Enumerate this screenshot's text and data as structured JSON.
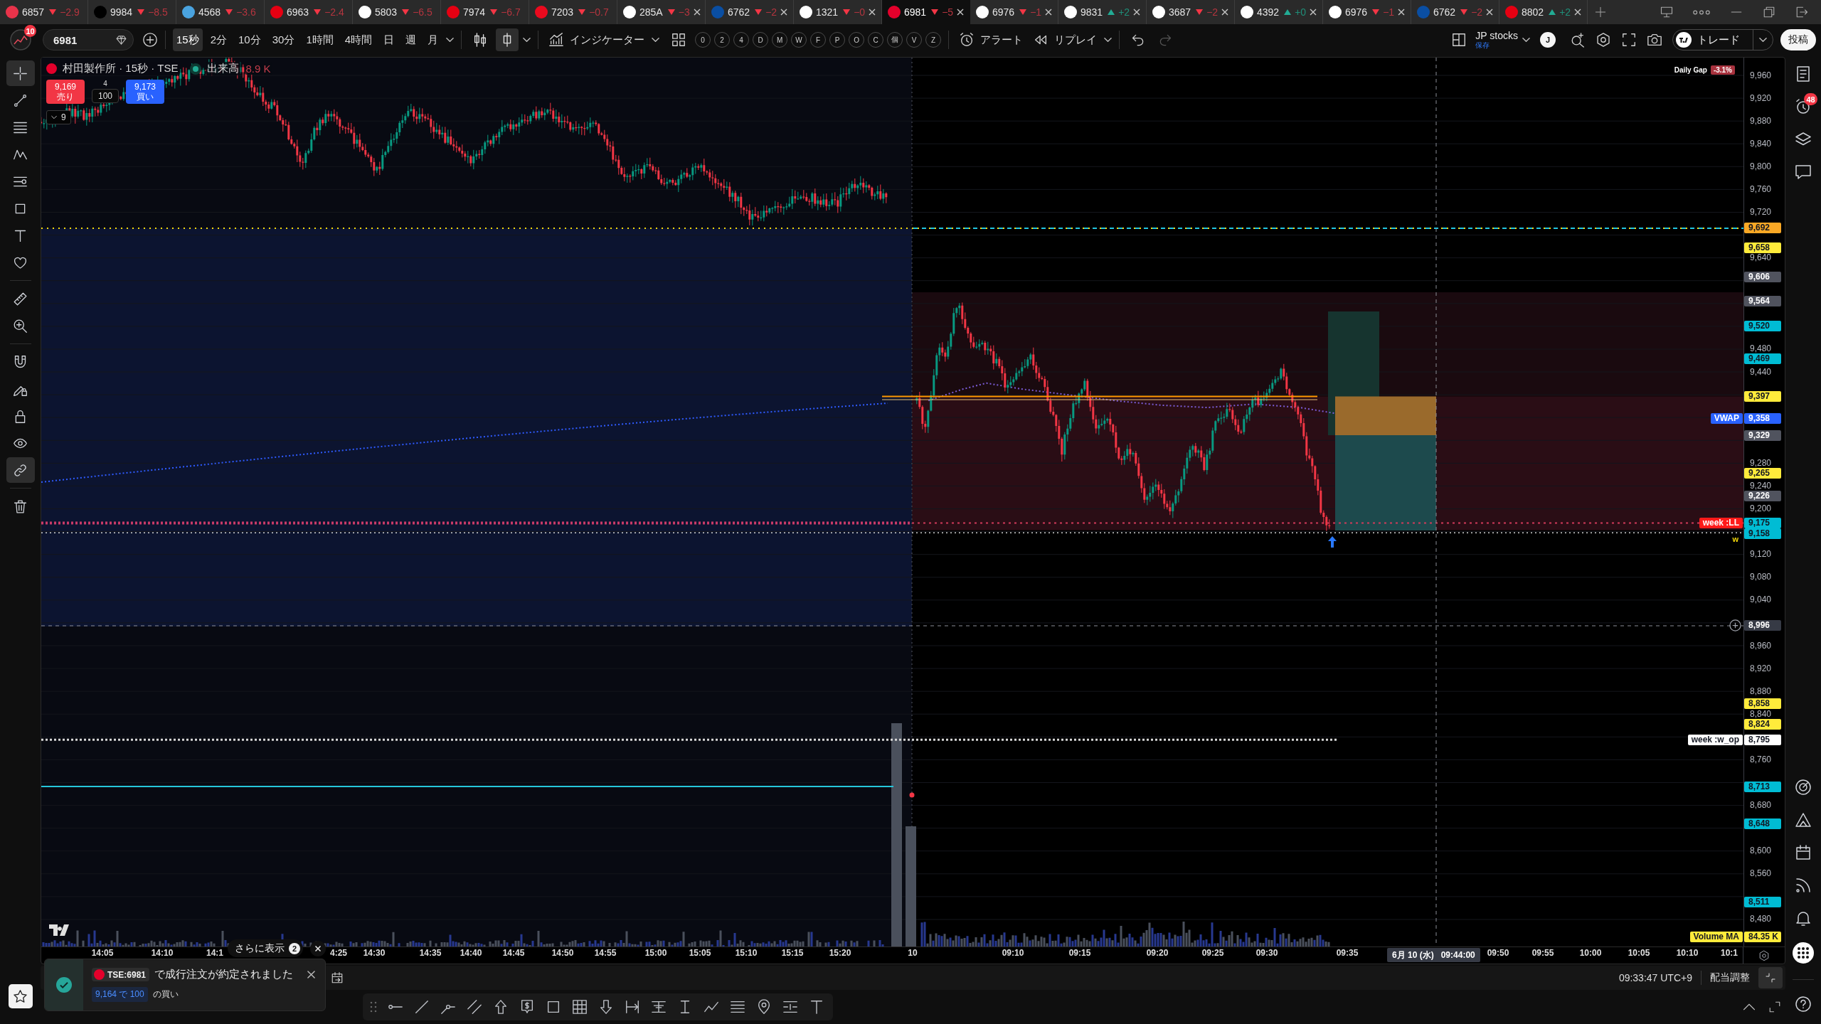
{
  "tabs": [
    {
      "symbol": "6857",
      "rising": false,
      "change": "−2.9",
      "color": "#e8334a",
      "closable": false,
      "selected": false
    },
    {
      "symbol": "9984",
      "rising": false,
      "change": "−8.5",
      "color": "#000000",
      "closable": false,
      "selected": false
    },
    {
      "symbol": "4568",
      "rising": false,
      "change": "−3.6",
      "color": "#4aa3df",
      "closable": false,
      "selected": false
    },
    {
      "symbol": "6963",
      "rising": false,
      "change": "−2.4",
      "color": "#e60012",
      "closable": false,
      "selected": false
    },
    {
      "symbol": "5803",
      "rising": false,
      "change": "−6.5",
      "color": "#ffffff",
      "closable": false,
      "selected": false
    },
    {
      "symbol": "7974",
      "rising": false,
      "change": "−6.7",
      "color": "#e60012",
      "closable": false,
      "selected": false
    },
    {
      "symbol": "7203",
      "rising": false,
      "change": "−0.7",
      "color": "#eb0a1e",
      "closable": false,
      "selected": false
    },
    {
      "symbol": "285A",
      "rising": false,
      "change": "−3",
      "color": "#ffffff",
      "closable": true,
      "selected": false
    },
    {
      "symbol": "6762",
      "rising": false,
      "change": "−2",
      "color": "#0a4ea2",
      "closable": true,
      "selected": false
    },
    {
      "symbol": "1321",
      "rising": false,
      "change": "−0",
      "color": "#ffffff",
      "closable": true,
      "selected": false
    },
    {
      "symbol": "6981",
      "rising": false,
      "change": "−5",
      "color": "#e4002b",
      "closable": true,
      "selected": true
    },
    {
      "symbol": "6976",
      "rising": false,
      "change": "−1",
      "color": "#ffffff",
      "closable": true,
      "selected": false
    },
    {
      "symbol": "9831",
      "rising": true,
      "change": "+2",
      "color": "#ffffff",
      "closable": true,
      "selected": false
    },
    {
      "symbol": "3687",
      "rising": false,
      "change": "−2",
      "color": "#ffffff",
      "closable": true,
      "selected": false
    },
    {
      "symbol": "4392",
      "rising": true,
      "change": "+0",
      "color": "#ffffff",
      "closable": true,
      "selected": false
    },
    {
      "symbol": "6976",
      "rising": false,
      "change": "−1",
      "color": "#ffffff",
      "closable": true,
      "selected": false
    },
    {
      "symbol": "6762",
      "rising": false,
      "change": "−2",
      "color": "#0a4ea2",
      "closable": true,
      "selected": false
    },
    {
      "symbol": "8802",
      "rising": true,
      "change": "+2",
      "color": "#e60012",
      "closable": true,
      "selected": false
    }
  ],
  "toolbar": {
    "notification_count": "10",
    "symbol": "6981",
    "intervals": [
      {
        "label": "15秒",
        "selected": true
      },
      {
        "label": "2分",
        "selected": false
      },
      {
        "label": "10分",
        "selected": false
      },
      {
        "label": "30分",
        "selected": false
      },
      {
        "label": "1時間",
        "selected": false
      },
      {
        "label": "4時間",
        "selected": false
      },
      {
        "label": "日",
        "selected": false
      },
      {
        "label": "週",
        "selected": false
      },
      {
        "label": "月",
        "selected": false
      }
    ],
    "chart_styles": [
      {
        "kind": "candles",
        "selected": false
      },
      {
        "kind": "hollow-candles",
        "selected": true
      }
    ],
    "indicators_label": "インジケーター",
    "quick_buttons": [
      "0",
      "2",
      "4",
      "D",
      "M",
      "W",
      "F",
      "P",
      "O",
      "C",
      "個",
      "V",
      "Z"
    ],
    "alert_label": "アラート",
    "replay_label": "リプレイ",
    "history": [
      {
        "kind": "undo",
        "disabled": false
      },
      {
        "kind": "redo",
        "disabled": true
      }
    ],
    "layout_name": "JP stocks",
    "layout_status": "保存",
    "account_initial": "J",
    "trade_label": "トレード",
    "publish_label": "投稿"
  },
  "left_toolbar": {
    "groups": [
      [
        {
          "kind": "crosshair",
          "selected": true
        },
        {
          "kind": "trend-line",
          "selected": false
        },
        {
          "kind": "fib",
          "selected": false
        },
        {
          "kind": "pattern",
          "selected": false
        },
        {
          "kind": "forecast",
          "selected": false
        },
        {
          "kind": "shape",
          "selected": false
        },
        {
          "kind": "text",
          "selected": false
        },
        {
          "kind": "heart",
          "selected": false
        }
      ],
      [
        {
          "kind": "ruler",
          "selected": false
        },
        {
          "kind": "zoom",
          "selected": false
        }
      ],
      [
        {
          "kind": "magnet",
          "selected": false
        },
        {
          "kind": "lock-pencil",
          "selected": false
        },
        {
          "kind": "lock",
          "selected": false
        },
        {
          "kind": "eye",
          "selected": false
        },
        {
          "kind": "link",
          "selected": true
        }
      ],
      [
        {
          "kind": "trash",
          "selected": false
        }
      ]
    ],
    "bottom": [
      {
        "kind": "star",
        "selected": false
      }
    ]
  },
  "chart": {
    "title": "村田製作所 · 15秒 · TSE",
    "market_open": true,
    "volume_label": "出来高",
    "volume_value": "8.9 K",
    "order_panel": {
      "sell_price": "9,169",
      "sell_label": "売り",
      "spread": "4",
      "quantity": "100",
      "buy_price": "9,173",
      "buy_label": "買い"
    },
    "indicator_count": "9",
    "daily_gap": {
      "label": "Daily Gap",
      "value": "-3.1%"
    },
    "level_marker": "w",
    "price_scale": [
      {
        "text": "9,960",
        "kind": "tick"
      },
      {
        "text": "9,920",
        "kind": "tick"
      },
      {
        "text": "9,880",
        "kind": "tick"
      },
      {
        "text": "9,840",
        "kind": "tick"
      },
      {
        "text": "9,800",
        "kind": "tick"
      },
      {
        "text": "9,760",
        "kind": "tick"
      },
      {
        "text": "9,720",
        "kind": "tick"
      },
      {
        "text": "9,692",
        "kind": "badge",
        "color": "#f9a825"
      },
      {
        "text": "9,658",
        "kind": "badge",
        "color": "#ffeb3b"
      },
      {
        "text": "9,640",
        "kind": "tick"
      },
      {
        "text": "9,606",
        "kind": "badge",
        "color": "#50535e"
      },
      {
        "text": "9,564",
        "kind": "badge",
        "color": "#50535e"
      },
      {
        "text": "9,520",
        "kind": "badge",
        "color": "#00bcd4"
      },
      {
        "text": "9,480",
        "kind": "tick"
      },
      {
        "text": "9,469",
        "kind": "badge",
        "color": "#00bcd4"
      },
      {
        "text": "9,440",
        "kind": "tick"
      },
      {
        "text": "9,397",
        "kind": "badge",
        "color": "#ffeb3b"
      },
      {
        "text": "9,358",
        "kind": "badge",
        "color": "#2962ff",
        "tag": {
          "text": "VWAP",
          "color": "#2962ff"
        }
      },
      {
        "text": "9,329",
        "kind": "badge",
        "color": "#50535e"
      },
      {
        "text": "9,280",
        "kind": "tick"
      },
      {
        "text": "9,265",
        "kind": "badge",
        "color": "#ffeb3b"
      },
      {
        "text": "9,240",
        "kind": "tick"
      },
      {
        "text": "9,226",
        "kind": "badge",
        "color": "#50535e"
      },
      {
        "text": "9,200",
        "kind": "tick"
      },
      {
        "text": "9,175",
        "kind": "badge",
        "color": "#00bcd4",
        "tag": {
          "text": "week :LL",
          "color": "#ff1a1a"
        }
      },
      {
        "text": "9,158",
        "kind": "badge",
        "color": "#00bcd4"
      },
      {
        "text": "9,120",
        "kind": "tick"
      },
      {
        "text": "9,080",
        "kind": "tick"
      },
      {
        "text": "9,040",
        "kind": "tick"
      },
      {
        "text": "8,996",
        "kind": "crosshair"
      },
      {
        "text": "8,960",
        "kind": "tick"
      },
      {
        "text": "8,920",
        "kind": "tick"
      },
      {
        "text": "8,880",
        "kind": "tick"
      },
      {
        "text": "8,858",
        "kind": "badge",
        "color": "#ffeb3b"
      },
      {
        "text": "8,840",
        "kind": "tick"
      },
      {
        "text": "8,824",
        "kind": "badge",
        "color": "#ffeb3b"
      },
      {
        "text": "8,795",
        "kind": "badge",
        "color": "#ffffff",
        "tag": {
          "text": "week :w_op",
          "color": "#ffffff"
        }
      },
      {
        "text": "8,760",
        "kind": "tick"
      },
      {
        "text": "8,713",
        "kind": "badge",
        "color": "#00bcd4"
      },
      {
        "text": "8,680",
        "kind": "tick"
      },
      {
        "text": "8,648",
        "kind": "badge",
        "color": "#00bcd4"
      },
      {
        "text": "8,600",
        "kind": "tick"
      },
      {
        "text": "8,560",
        "kind": "tick"
      },
      {
        "text": "8,511",
        "kind": "badge",
        "color": "#00bcd4"
      },
      {
        "text": "8,480",
        "kind": "tick"
      }
    ],
    "volume_ma": {
      "label": "Volume MA",
      "value": "84.35 K"
    },
    "time_scale": [
      "14:05",
      "14:10",
      "14:1",
      "4:25",
      "14:30",
      "14:35",
      "14:40",
      "14:45",
      "14:50",
      "14:55",
      "15:00",
      "15:05",
      "15:10",
      "15:15",
      "15:20",
      "10",
      "09:10",
      "09:15",
      "09:20",
      "09:25",
      "09:30",
      "09:35",
      "09:50",
      "09:55",
      "10:00",
      "10:05",
      "10:10",
      "10:1"
    ],
    "crosshair_time": {
      "date": "6月 10 (水)",
      "time": "09:44:00"
    }
  },
  "right_sidebar": {
    "alerts_badge": "48"
  },
  "status_bar": {
    "clock": "09:33:47 UTC+9",
    "adjustment_label": "配当調整"
  },
  "notification": {
    "symbol": "TSE:6981",
    "message": "で成行注文が約定されました",
    "fill": "9,164 で 100",
    "side": "の買い"
  },
  "more_notifications": {
    "label": "さらに表示",
    "count": "2"
  }
}
